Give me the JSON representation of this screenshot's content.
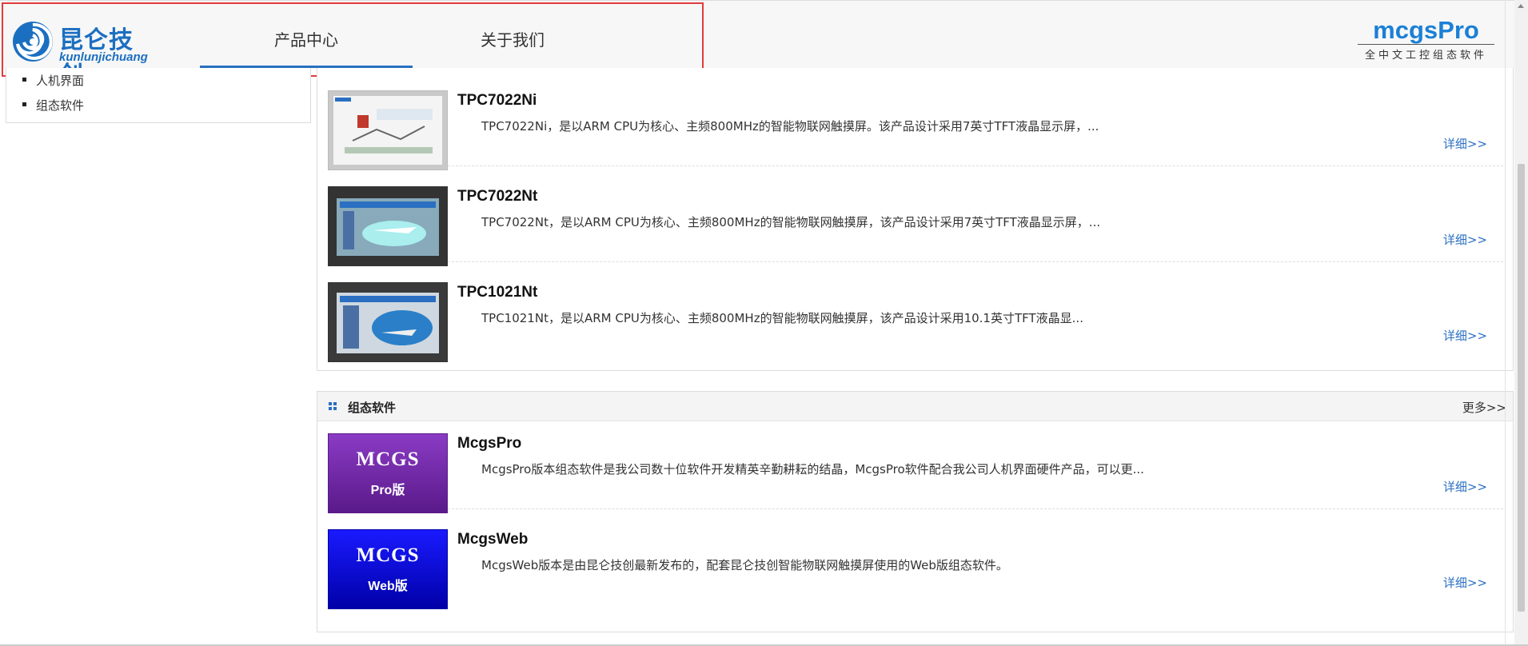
{
  "header": {
    "logo_cn": "昆仑技创",
    "logo_en": "kunlunjichuang",
    "nav": [
      "产品中心",
      "关于我们"
    ],
    "brand_title": "mcgsPro",
    "brand_sub": "全中文工控组态软件",
    "accent_color": "#2a6fc1",
    "highlight_color": "#e03c3c"
  },
  "sidebar": {
    "items": [
      "人机界面",
      "组态软件"
    ]
  },
  "hmi": {
    "products": [
      {
        "name": "TPC7022Ni",
        "desc": "TPC7022Ni，是以ARM CPU为核心、主频800MHz的智能物联网触摸屏。该产品设计采用7英寸TFT液晶显示屏，...",
        "link": "详细>>"
      },
      {
        "name": "TPC7022Nt",
        "desc": "TPC7022Nt，是以ARM CPU为核心、主频800MHz的智能物联网触摸屏，该产品设计采用7英寸TFT液晶显示屏，...",
        "link": "详细>>"
      },
      {
        "name": "TPC1021Nt",
        "desc": "TPC1021Nt，是以ARM CPU为核心、主频800MHz的智能物联网触摸屏，该产品设计采用10.1英寸TFT液晶显...",
        "link": "详细>>"
      }
    ]
  },
  "software": {
    "title": "组态软件",
    "more": "更多>>",
    "products": [
      {
        "name": "McgsPro",
        "desc": "McgsPro版本组态软件是我公司数十位软件开发精英辛勤耕耘的结晶，McgsPro软件配合我公司人机界面硬件产品，可以更...",
        "link": "详细>>",
        "thumb_big": "MCGS",
        "thumb_small": "Pro版"
      },
      {
        "name": "McgsWeb",
        "desc": "McgsWeb版本是由昆仑技创最新发布的，配套昆仑技创智能物联网触摸屏使用的Web版组态软件。",
        "link": "详细>>",
        "thumb_big": "MCGS",
        "thumb_small": "Web版"
      }
    ]
  }
}
